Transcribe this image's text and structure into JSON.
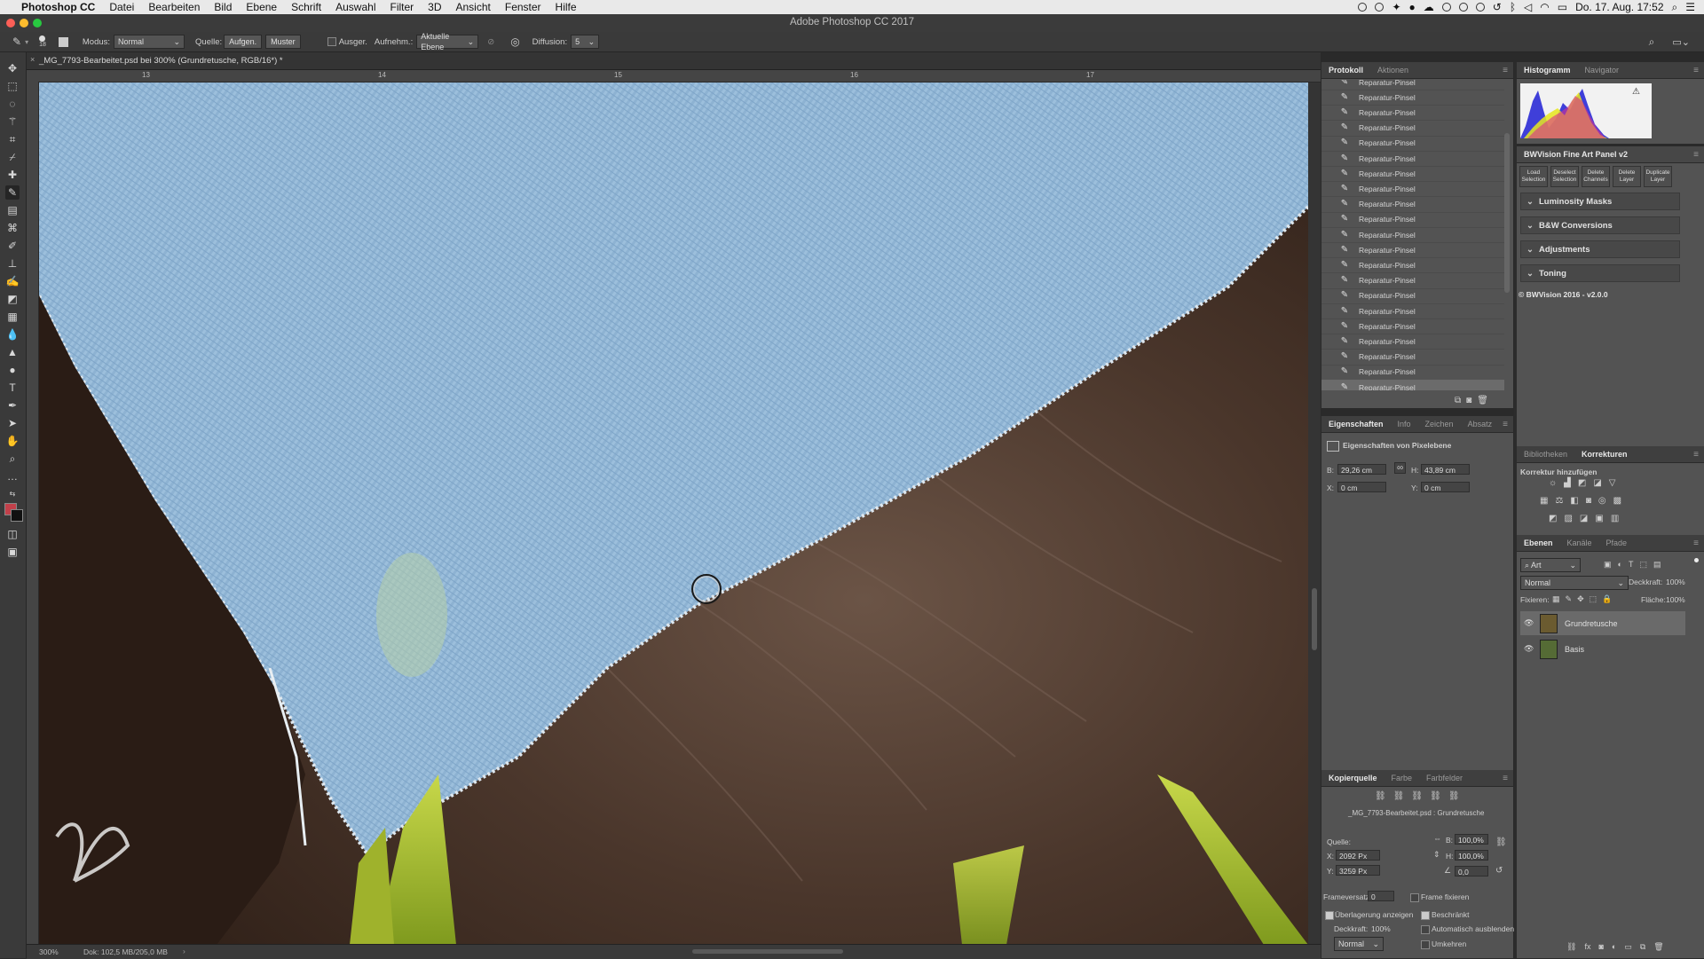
{
  "menubar": {
    "apple": "",
    "app_name": "Photoshop CC",
    "items": [
      "Datei",
      "Bearbeiten",
      "Bild",
      "Ebene",
      "Schrift",
      "Auswahl",
      "Filter",
      "3D",
      "Ansicht",
      "Fenster",
      "Hilfe"
    ],
    "clock": "Do. 17. Aug.  17:52"
  },
  "window": {
    "title": "Adobe Photoshop CC 2017"
  },
  "options": {
    "brush_size": "18",
    "mode_label": "Modus:",
    "mode_value": "Normal",
    "source_label": "Quelle:",
    "source_sampled": "Aufgen.",
    "source_pattern": "Muster",
    "aligned_label": "Ausger.",
    "sample_label": "Aufnehm.:",
    "sample_value": "Aktuelle Ebene",
    "diffusion_label": "Diffusion:",
    "diffusion_value": "5"
  },
  "document": {
    "tab_title": "_MG_7793-Bearbeitet.psd bei 300% (Grundretusche, RGB/16*) *",
    "ruler_top": [
      "13",
      "14",
      "15",
      "16",
      "17"
    ],
    "zoom": "300%",
    "doc_info": "Dok: 102,5 MB/205,0 MB"
  },
  "history_panel": {
    "tabs": [
      "Protokoll",
      "Aktionen"
    ],
    "items": [
      "Reparatur-Pinsel",
      "Reparatur-Pinsel",
      "Reparatur-Pinsel",
      "Reparatur-Pinsel",
      "Reparatur-Pinsel",
      "Reparatur-Pinsel",
      "Reparatur-Pinsel",
      "Reparatur-Pinsel",
      "Reparatur-Pinsel",
      "Reparatur-Pinsel",
      "Reparatur-Pinsel",
      "Reparatur-Pinsel",
      "Reparatur-Pinsel",
      "Reparatur-Pinsel",
      "Reparatur-Pinsel",
      "Reparatur-Pinsel",
      "Reparatur-Pinsel",
      "Reparatur-Pinsel",
      "Reparatur-Pinsel",
      "Reparatur-Pinsel",
      "Reparatur-Pinsel"
    ]
  },
  "properties_panel": {
    "tabs": [
      "Eigenschaften",
      "Info",
      "Zeichen",
      "Absatz"
    ],
    "heading": "Eigenschaften von Pixelebene",
    "w_label": "B:",
    "w_value": "29,26 cm",
    "h_label": "H:",
    "h_value": "43,89 cm",
    "x_label": "X:",
    "x_value": "0 cm",
    "y_label": "Y:",
    "y_value": "0 cm"
  },
  "clone_source_panel": {
    "tabs": [
      "Kopierquelle",
      "Farbe",
      "Farbfelder"
    ],
    "file": "_MG_7793-Bearbeitet.psd : Grundretusche",
    "source_label": "Quelle:",
    "x_label": "X:",
    "x_value": "2092 Px",
    "y_label": "Y:",
    "y_value": "3259 Px",
    "w_label": "B:",
    "w_value": "100,0%",
    "h_label": "H:",
    "h_value": "100,0%",
    "angle_value": "0,0",
    "frame_offset_label": "Frameversatz:",
    "frame_offset_value": "0",
    "frame_lock_label": "Frame fixieren",
    "show_overlay_label": "Überlagerung anzeigen",
    "clipped_label": "Beschränkt",
    "opacity_label": "Deckkraft:",
    "opacity_value": "100%",
    "auto_hide_label": "Automatisch ausblenden",
    "blend_value": "Normal",
    "invert_label": "Umkehren"
  },
  "histogram_panel": {
    "tabs": [
      "Histogramm",
      "Navigator"
    ]
  },
  "bwvision_panel": {
    "title": "BWVision Fine Art Panel v2",
    "buttons": [
      {
        "line1": "Load",
        "line2": "Selection"
      },
      {
        "line1": "Deselect",
        "line2": "Selection"
      },
      {
        "line1": "Delete",
        "line2": "Channels"
      },
      {
        "line1": "Delete",
        "line2": "Layer"
      },
      {
        "line1": "Duplicate",
        "line2": "Layer"
      }
    ],
    "sections": [
      "Luminosity Masks",
      "B&W Conversions",
      "Adjustments",
      "Toning"
    ],
    "footer": "© BWVision 2016 - v2.0.0"
  },
  "adjustments_panel": {
    "tabs": [
      "Bibliotheken",
      "Korrekturen"
    ],
    "add_label": "Korrektur hinzufügen"
  },
  "layers_panel": {
    "tabs": [
      "Ebenen",
      "Kanäle",
      "Pfade"
    ],
    "filter_value": "Art",
    "blend_value": "Normal",
    "opacity_label": "Deckkraft:",
    "opacity_value": "100%",
    "lock_label": "Fixieren:",
    "fill_label": "Fläche:",
    "fill_value": "100%",
    "layers": [
      {
        "name": "Grundretusche",
        "selected": true
      },
      {
        "name": "Basis",
        "selected": false
      }
    ]
  },
  "colors": {
    "accent": "#4a90d9",
    "panel": "#535353",
    "dark": "#3a3a3a",
    "denim": "#8fb4d4"
  }
}
